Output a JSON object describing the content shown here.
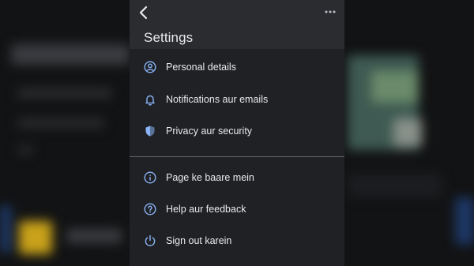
{
  "header": {
    "title": "Settings",
    "back_icon": "chevron-left-icon",
    "more_icon": "more-horizontal-icon"
  },
  "sections": [
    {
      "items": [
        {
          "label": "Personal details",
          "icon": "account-circle-icon"
        },
        {
          "label": "Notifications aur emails",
          "icon": "bell-icon"
        },
        {
          "label": "Privacy aur security",
          "icon": "shield-icon"
        }
      ]
    },
    {
      "items": [
        {
          "label": "Page ke baare mein",
          "icon": "info-icon"
        },
        {
          "label": "Help aur feedback",
          "icon": "help-icon"
        },
        {
          "label": "Sign out karein",
          "icon": "power-icon"
        }
      ]
    }
  ],
  "colors": {
    "panel_background": "#202124",
    "header_background": "#2b2c30",
    "icon_accent": "#8ab4f8",
    "text": "#e8eaed"
  }
}
